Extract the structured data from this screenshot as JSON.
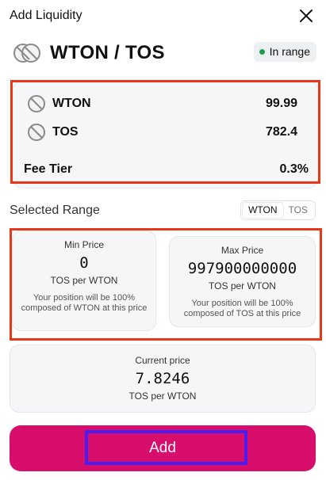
{
  "header": {
    "title": "Add Liquidity"
  },
  "pair": {
    "name": "WTON / TOS",
    "status": "In range",
    "status_color": "#1e9b4f"
  },
  "tokens": [
    {
      "symbol": "WTON",
      "amount": "99.99"
    },
    {
      "symbol": "TOS",
      "amount": "782.4"
    }
  ],
  "fee": {
    "label": "Fee Tier",
    "value": "0.3%"
  },
  "range": {
    "label": "Selected Range",
    "toggle": [
      "WTON",
      "TOS"
    ],
    "toggle_active": "WTON",
    "min": {
      "label": "Min Price",
      "value": "0",
      "unit": "TOS per WTON",
      "note": "Your position will be 100% composed of WTON at this price"
    },
    "max": {
      "label": "Max Price",
      "value": "997900000000",
      "unit": "TOS per WTON",
      "note": "Your position will be 100% composed of TOS at this price"
    }
  },
  "current": {
    "label": "Current price",
    "value": "7.8246",
    "unit": "TOS per WTON"
  },
  "add_button": {
    "label": "Add"
  },
  "colors": {
    "accent": "#d80e6c",
    "highlight_red": "#e8381a",
    "highlight_blue": "#4a1ef0"
  }
}
